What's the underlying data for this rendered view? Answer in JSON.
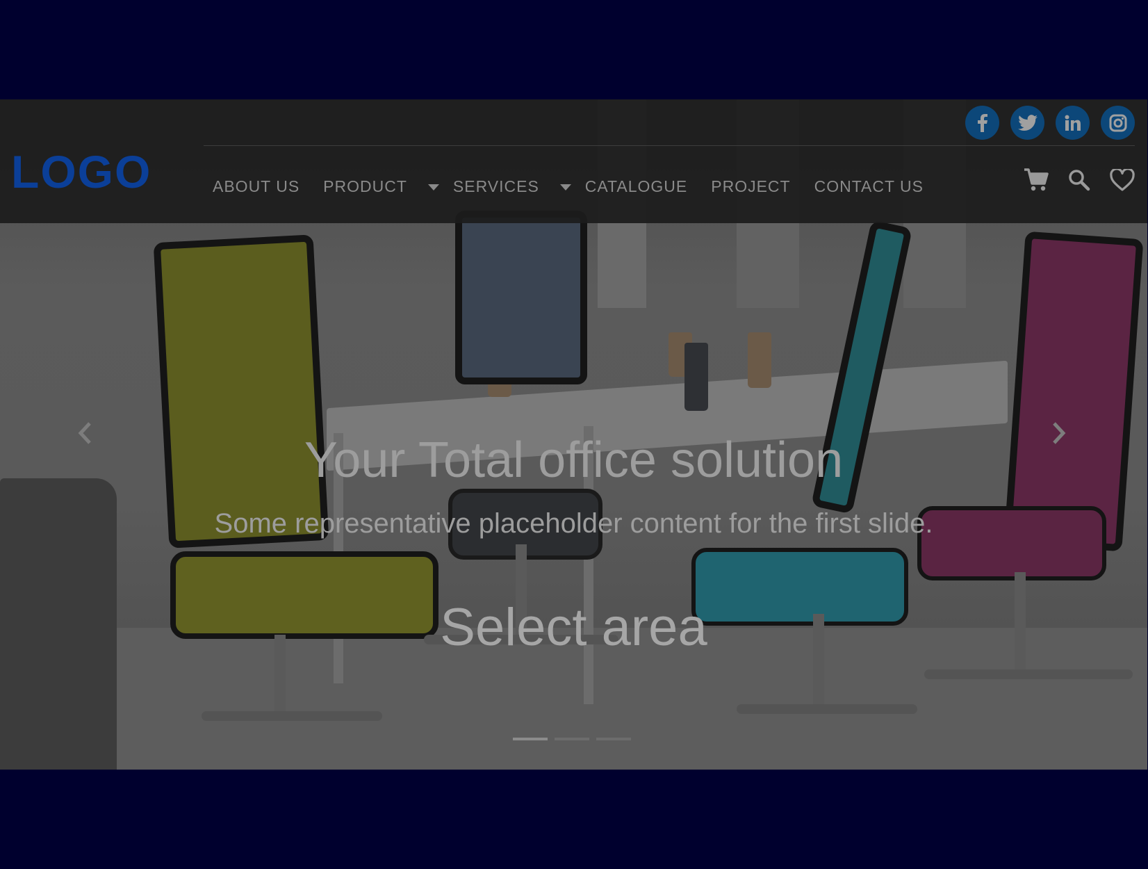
{
  "brand": {
    "logo_text": "LOGO",
    "logo_color": "#0b3f98"
  },
  "social": [
    {
      "name": "facebook-icon",
      "glyph": "f"
    },
    {
      "name": "twitter-icon",
      "glyph": "bird"
    },
    {
      "name": "linkedin-icon",
      "glyph": "in"
    },
    {
      "name": "instagram-icon",
      "glyph": "camera"
    }
  ],
  "nav": {
    "about": "ABOUT US",
    "product": "PRODUCT",
    "services": "SERVICES",
    "catalogue": "CATALOGUE",
    "project": "PROJECT",
    "contact": "CONTACT US"
  },
  "tools": {
    "cart_icon": "cart-icon",
    "search_icon": "search-icon",
    "wishlist_icon": "heart-icon"
  },
  "hero": {
    "title": "Your Total office solution",
    "subtitle": "Some representative placeholder content for the first slide.",
    "cta": "Select area",
    "slides_total": 3,
    "active_slide": 1
  },
  "colors": {
    "page_bg": "#00002e",
    "social_bg": "#0c4779",
    "nav_text": "#8a8a8a"
  }
}
